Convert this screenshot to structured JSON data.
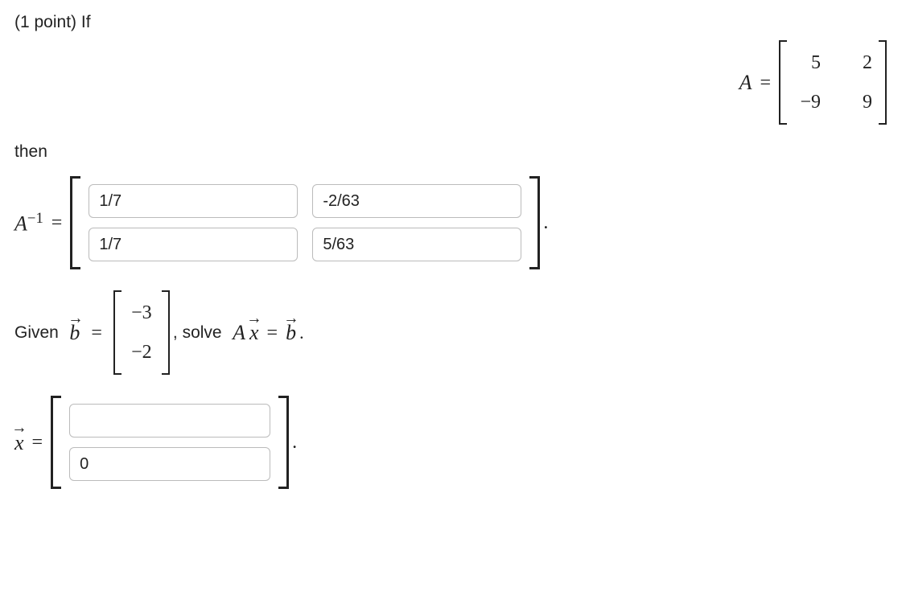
{
  "prompt": {
    "points_prefix": "(1 point)",
    "if_text": "If",
    "then_text": "then",
    "given_prefix": "Given",
    "solve_text": ", solve",
    "period": "."
  },
  "matrixA": {
    "label": "A",
    "r1c1": "5",
    "r1c2": "2",
    "r2c1": "−9",
    "r2c2": "9"
  },
  "Ainv": {
    "label_base": "A",
    "label_exp": "−1",
    "eq": "=",
    "inputs": {
      "r1c1": "1/7",
      "r1c2": "-2/63",
      "r2c1": "1/7",
      "r2c2": "5/63"
    }
  },
  "vectorB": {
    "labelvar": "b",
    "r1": "−3",
    "r2": "−2"
  },
  "equationAxb": {
    "A": "A",
    "x": "x",
    "eqsign": "=",
    "b": "b",
    "end": "."
  },
  "vectorX": {
    "labelvar": "x",
    "eq": "=",
    "inputs": {
      "r1": "",
      "r2": "0"
    }
  }
}
